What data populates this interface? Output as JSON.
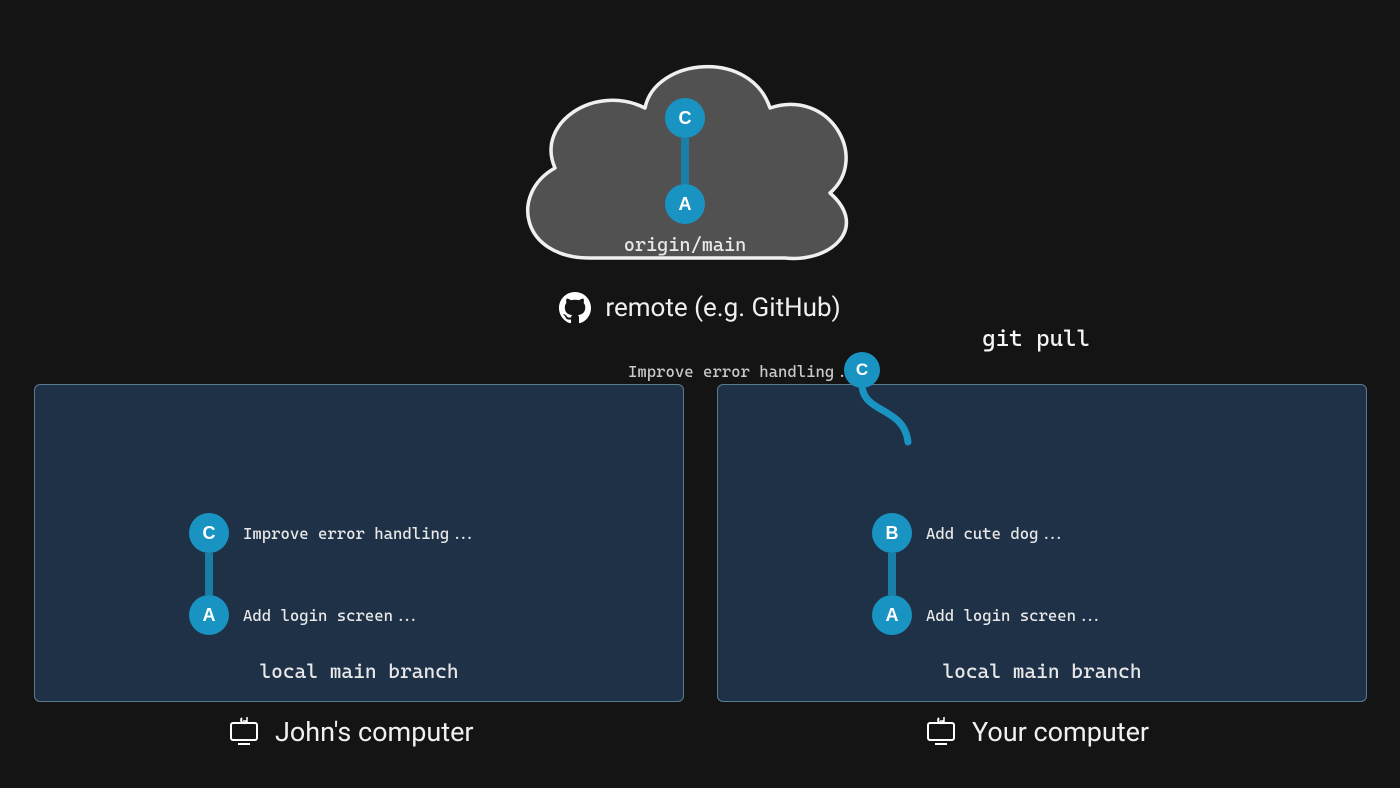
{
  "remote": {
    "branch_label": "origin/main",
    "caption": "remote (e.g. GitHub)",
    "commits": {
      "top": "C",
      "bottom": "A"
    }
  },
  "command": "git pull",
  "floating_commit": {
    "id": "C",
    "message": "Improve error handling..."
  },
  "panels": {
    "left": {
      "caption": "John's computer",
      "branch_label": "local main branch",
      "commits": [
        {
          "id": "C",
          "message": "Improve error handling..."
        },
        {
          "id": "A",
          "message": "Add login screen..."
        }
      ]
    },
    "right": {
      "caption": "Your computer",
      "branch_label": "local main branch",
      "commits": [
        {
          "id": "B",
          "message": "Add cute dog..."
        },
        {
          "id": "A",
          "message": "Add login screen..."
        }
      ]
    }
  },
  "colors": {
    "bg": "#141414",
    "panel": "#1f3147",
    "panel_border": "#5a7a8f",
    "commit": "#1994c2",
    "commit_line": "#197fa7",
    "cloud_fill": "#515151",
    "cloud_stroke": "#f0f0f0"
  }
}
